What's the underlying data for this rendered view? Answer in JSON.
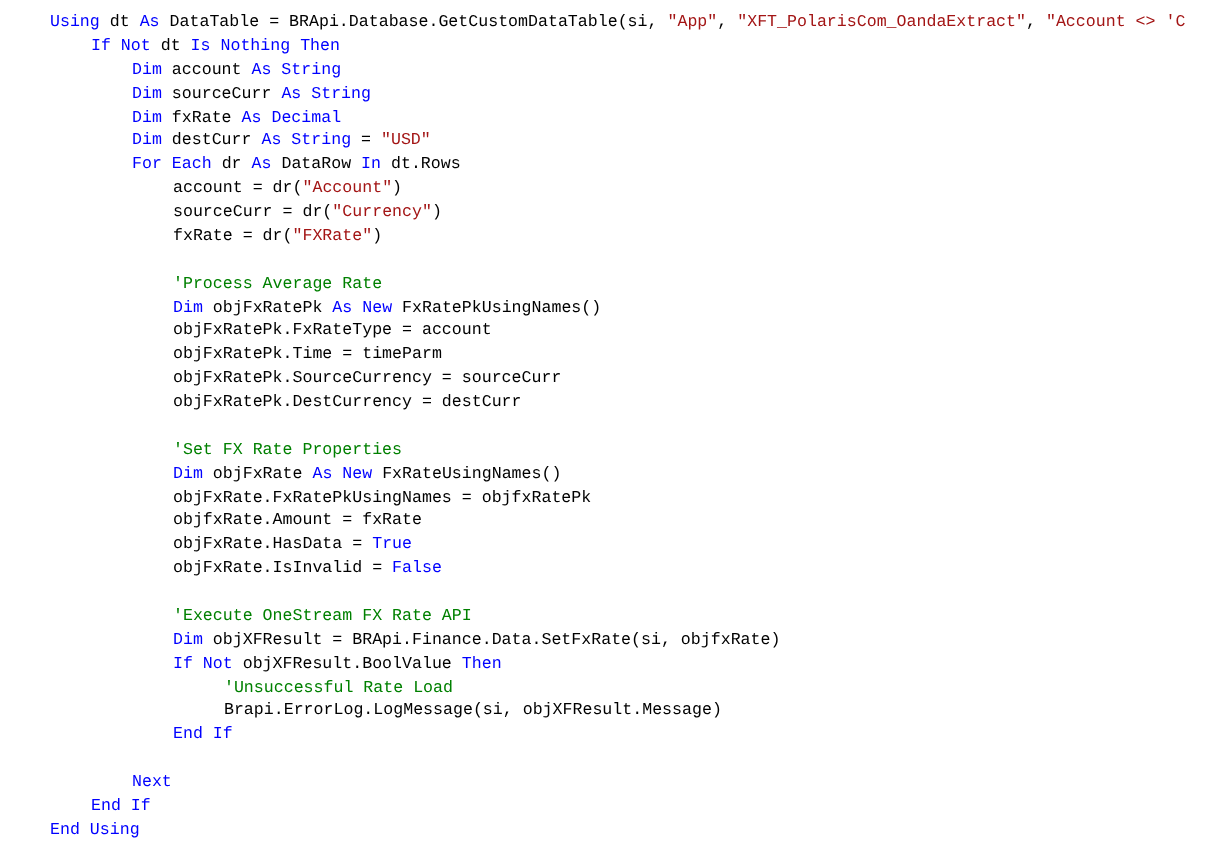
{
  "code_editor": {
    "lines": [
      {
        "kind": "code",
        "tokens": [
          {
            "kind": "keyword",
            "text": "Using"
          },
          {
            "kind": "plain",
            "text": " dt "
          },
          {
            "kind": "keyword",
            "text": "As"
          },
          {
            "kind": "plain",
            "text": " DataTable = BRApi.Database.GetCustomDataTable(si, "
          },
          {
            "kind": "string",
            "text": "\"App\""
          },
          {
            "kind": "plain",
            "text": ", "
          },
          {
            "kind": "string",
            "text": "\"XFT_PolarisCom_OandaExtract\""
          },
          {
            "kind": "plain",
            "text": ", "
          },
          {
            "kind": "string",
            "text": "\"Account <> 'C"
          }
        ],
        "children": [
          {
            "kind": "code",
            "tokens": [
              {
                "kind": "keyword",
                "text": "If Not"
              },
              {
                "kind": "plain",
                "text": " dt "
              },
              {
                "kind": "keyword",
                "text": "Is Nothing Then"
              }
            ],
            "children": [
              {
                "kind": "code",
                "tokens": [
                  {
                    "kind": "keyword",
                    "text": "Dim"
                  },
                  {
                    "kind": "plain",
                    "text": " account "
                  },
                  {
                    "kind": "keyword",
                    "text": "As String"
                  }
                ]
              },
              {
                "kind": "code",
                "tokens": [
                  {
                    "kind": "keyword",
                    "text": "Dim"
                  },
                  {
                    "kind": "plain",
                    "text": " sourceCurr "
                  },
                  {
                    "kind": "keyword",
                    "text": "As String"
                  }
                ]
              },
              {
                "kind": "code",
                "tokens": [
                  {
                    "kind": "keyword",
                    "text": "Dim"
                  },
                  {
                    "kind": "plain",
                    "text": " fxRate "
                  },
                  {
                    "kind": "keyword",
                    "text": "As Decimal"
                  }
                ]
              },
              {
                "kind": "code",
                "tokens": [
                  {
                    "kind": "keyword",
                    "text": "Dim"
                  },
                  {
                    "kind": "plain",
                    "text": " destCurr "
                  },
                  {
                    "kind": "keyword",
                    "text": "As String"
                  },
                  {
                    "kind": "plain",
                    "text": " = "
                  },
                  {
                    "kind": "string",
                    "text": "\"USD\""
                  }
                ]
              },
              {
                "kind": "code",
                "tokens": [
                  {
                    "kind": "keyword",
                    "text": "For Each"
                  },
                  {
                    "kind": "plain",
                    "text": " dr "
                  },
                  {
                    "kind": "keyword",
                    "text": "As"
                  },
                  {
                    "kind": "plain",
                    "text": " DataRow "
                  },
                  {
                    "kind": "keyword",
                    "text": "In"
                  },
                  {
                    "kind": "plain",
                    "text": " dt.Rows"
                  }
                ],
                "children": [
                  {
                    "kind": "code",
                    "tokens": [
                      {
                        "kind": "plain",
                        "text": "account = dr("
                      },
                      {
                        "kind": "string",
                        "text": "\"Account\""
                      },
                      {
                        "kind": "plain",
                        "text": ")"
                      }
                    ]
                  },
                  {
                    "kind": "code",
                    "tokens": [
                      {
                        "kind": "plain",
                        "text": "sourceCurr = dr("
                      },
                      {
                        "kind": "string",
                        "text": "\"Currency\""
                      },
                      {
                        "kind": "plain",
                        "text": ")"
                      }
                    ]
                  },
                  {
                    "kind": "code",
                    "tokens": [
                      {
                        "kind": "plain",
                        "text": "fxRate = dr("
                      },
                      {
                        "kind": "string",
                        "text": "\"FXRate\""
                      },
                      {
                        "kind": "plain",
                        "text": ")"
                      }
                    ]
                  },
                  {
                    "kind": "blank"
                  },
                  {
                    "kind": "code",
                    "tokens": [
                      {
                        "kind": "comment",
                        "text": "'Process Average Rate"
                      }
                    ]
                  },
                  {
                    "kind": "code",
                    "tokens": [
                      {
                        "kind": "keyword",
                        "text": "Dim"
                      },
                      {
                        "kind": "plain",
                        "text": " objFxRatePk "
                      },
                      {
                        "kind": "keyword",
                        "text": "As New"
                      },
                      {
                        "kind": "plain",
                        "text": " FxRatePkUsingNames()"
                      }
                    ]
                  },
                  {
                    "kind": "code",
                    "tokens": [
                      {
                        "kind": "plain",
                        "text": "objFxRatePk.FxRateType = account"
                      }
                    ]
                  },
                  {
                    "kind": "code",
                    "tokens": [
                      {
                        "kind": "plain",
                        "text": "objFxRatePk.Time = timeParm"
                      }
                    ]
                  },
                  {
                    "kind": "code",
                    "tokens": [
                      {
                        "kind": "plain",
                        "text": "objFxRatePk.SourceCurrency = sourceCurr"
                      }
                    ]
                  },
                  {
                    "kind": "code",
                    "tokens": [
                      {
                        "kind": "plain",
                        "text": "objFxRatePk.DestCurrency = destCurr"
                      }
                    ]
                  },
                  {
                    "kind": "blank"
                  },
                  {
                    "kind": "code",
                    "tokens": [
                      {
                        "kind": "comment",
                        "text": "'Set FX Rate Properties"
                      }
                    ]
                  },
                  {
                    "kind": "code",
                    "tokens": [
                      {
                        "kind": "keyword",
                        "text": "Dim"
                      },
                      {
                        "kind": "plain",
                        "text": " objFxRate "
                      },
                      {
                        "kind": "keyword",
                        "text": "As New"
                      },
                      {
                        "kind": "plain",
                        "text": " FxRateUsingNames()"
                      }
                    ]
                  },
                  {
                    "kind": "code",
                    "tokens": [
                      {
                        "kind": "plain",
                        "text": "objFxRate.FxRatePkUsingNames = objfxRatePk"
                      }
                    ]
                  },
                  {
                    "kind": "code",
                    "tokens": [
                      {
                        "kind": "plain",
                        "text": "objfxRate.Amount = fxRate"
                      }
                    ]
                  },
                  {
                    "kind": "code",
                    "tokens": [
                      {
                        "kind": "plain",
                        "text": "objFxRate.HasData = "
                      },
                      {
                        "kind": "keyword",
                        "text": "True"
                      }
                    ]
                  },
                  {
                    "kind": "code",
                    "tokens": [
                      {
                        "kind": "plain",
                        "text": "objFxRate.IsInvalid = "
                      },
                      {
                        "kind": "keyword",
                        "text": "False"
                      }
                    ]
                  },
                  {
                    "kind": "blank"
                  },
                  {
                    "kind": "code",
                    "tokens": [
                      {
                        "kind": "comment",
                        "text": "'Execute OneStream FX Rate API"
                      }
                    ]
                  },
                  {
                    "kind": "code",
                    "tokens": [
                      {
                        "kind": "keyword",
                        "text": "Dim"
                      },
                      {
                        "kind": "plain",
                        "text": " objXFResult = BRApi.Finance.Data.SetFxRate(si, objfxRate)"
                      }
                    ]
                  },
                  {
                    "kind": "code",
                    "tokens": [
                      {
                        "kind": "keyword",
                        "text": "If Not"
                      },
                      {
                        "kind": "plain",
                        "text": " objXFResult.BoolValue "
                      },
                      {
                        "kind": "keyword",
                        "text": "Then"
                      }
                    ],
                    "children": [
                      {
                        "kind": "code",
                        "tokens": [
                          {
                            "kind": "comment",
                            "text": " 'Unsuccessful Rate Load"
                          }
                        ]
                      },
                      {
                        "kind": "code",
                        "tokens": [
                          {
                            "kind": "plain",
                            "text": " Brapi.ErrorLog.LogMessage(si, objXFResult.Message)"
                          }
                        ]
                      }
                    ]
                  },
                  {
                    "kind": "code",
                    "tokens": [
                      {
                        "kind": "keyword",
                        "text": "End If"
                      }
                    ]
                  },
                  {
                    "kind": "blank"
                  }
                ]
              },
              {
                "kind": "code",
                "tokens": [
                  {
                    "kind": "keyword",
                    "text": "Next"
                  }
                ]
              }
            ]
          },
          {
            "kind": "code",
            "tokens": [
              {
                "kind": "keyword",
                "text": "End If"
              }
            ]
          }
        ]
      },
      {
        "kind": "code",
        "tokens": [
          {
            "kind": "keyword",
            "text": "End Using"
          }
        ]
      }
    ]
  }
}
